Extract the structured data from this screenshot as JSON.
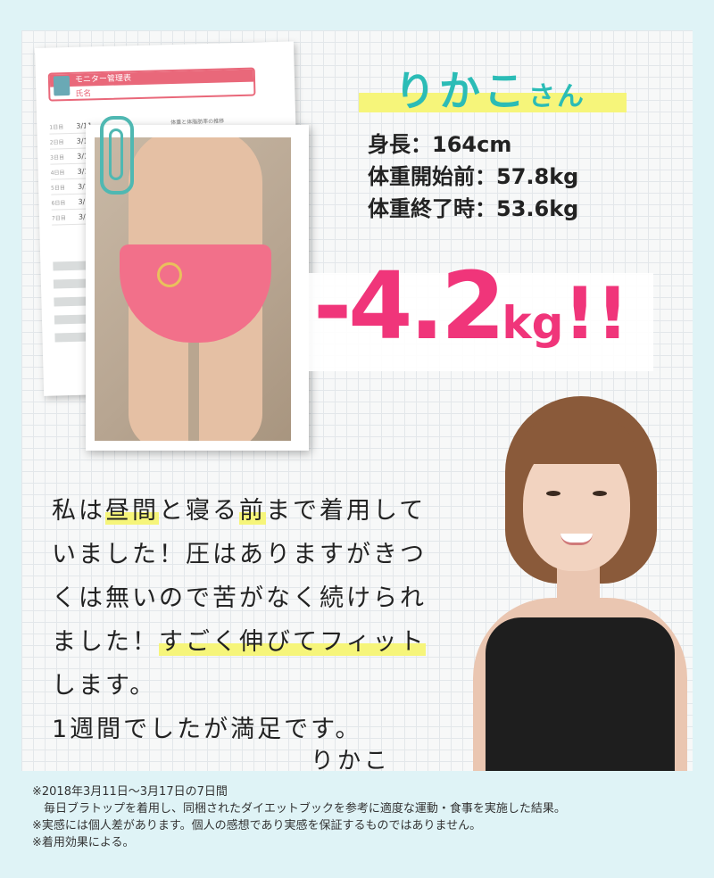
{
  "sheet": {
    "title": "モニター管理表",
    "name_label": "氏名",
    "chart_title": "体重と体脂肪率の推移",
    "dates": [
      "3/11",
      "3/12",
      "3/13",
      "3/14",
      "3/15",
      "3/16",
      "3/17"
    ]
  },
  "profile": {
    "name": "りかこ",
    "honorific": "さん",
    "height": "身長：164cm",
    "weight_before": "体重開始前：57.8kg",
    "weight_after": "体重終了時：53.6kg"
  },
  "result": {
    "sign": "-",
    "number": "4.2",
    "unit": "kg",
    "exclaim": "!!"
  },
  "comment": {
    "line1_pre": "私は",
    "line1_hl1": "昼間",
    "line1_mid": "と寝る",
    "line1_hl2": "前",
    "line1_post": "まで着用して",
    "line2": "いました！圧はありますがきつ",
    "line3": "くは無いので苦がなく続けられ",
    "line4_pre": "ました！",
    "line4_hl": "すごく伸びてフィット",
    "line5": "します。",
    "line6": "1週間でしたが満足です。",
    "signature": "りかこ"
  },
  "notes": [
    "※2018年3月11日～3月17日の7日間",
    "　毎日ブラトップを着用し、同梱されたダイエットブックを参考に適度な運動・食事を実施した結果。",
    "※実感には個人差があります。個人の感想であり実感を保証するものではありません。",
    "※着用効果による。"
  ]
}
